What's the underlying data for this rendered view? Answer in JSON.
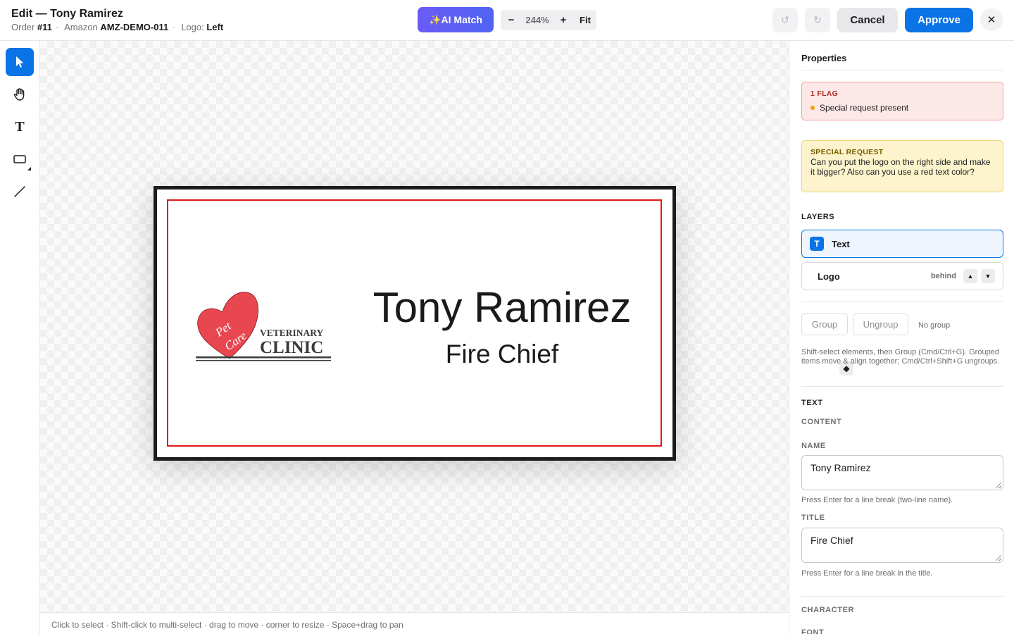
{
  "header": {
    "title": "Edit — Tony Ramirez",
    "order_label": "Order",
    "order_value": "#11",
    "marketplace_label": "Amazon",
    "marketplace_value": "AMZ-DEMO-011",
    "logo_label": "Logo:",
    "logo_value": "Left",
    "ai_match_label": "✨AI Match",
    "zoom_out": "−",
    "zoom_level": "244%",
    "zoom_in": "+",
    "fit_label": "Fit",
    "undo_icon": "↺",
    "redo_icon": "↻",
    "cancel_label": "Cancel",
    "approve_label": "Approve",
    "close_icon": "✕"
  },
  "tools": {
    "items": [
      "select-tool",
      "pan-tool",
      "text-tool",
      "shape-tool",
      "line-tool"
    ],
    "active": "select-tool",
    "text_tool_glyph": "T"
  },
  "badge": {
    "name": "Tony Ramirez",
    "title": "Fire Chief",
    "logo": {
      "heart_text_1": "Pet",
      "heart_text_2": "Care",
      "line_1": "VETERINARY",
      "line_2": "CLINIC"
    },
    "colors": {
      "frame": "#1c1c1c",
      "safe_zone": "#e01818",
      "heart": "#e8474f"
    }
  },
  "hint_bar": "Click to select · Shift-click to multi-select · drag to move · corner to resize · Space+drag to pan",
  "panel": {
    "title": "Properties",
    "flags": {
      "count_label": "1 FLAG",
      "items": [
        "Special request present"
      ]
    },
    "special_request": {
      "label": "SPECIAL REQUEST",
      "text": "Can you put the logo on the right side and make it bigger? Also can you use a red text color?"
    },
    "layers": {
      "label": "LAYERS",
      "items": [
        {
          "name": "Text",
          "icon": "T",
          "selected": true
        },
        {
          "name": "Logo",
          "icon": "◆",
          "note": "behind",
          "up": "▲",
          "down": "▼"
        }
      ]
    },
    "grouping": {
      "group_label": "Group",
      "ungroup_label": "Ungroup",
      "status": "No group",
      "help": "Shift-select elements, then Group (Cmd/Ctrl+G). Grouped items move & align together; Cmd/Ctrl+Shift+G ungroups."
    },
    "text_section": {
      "label": "TEXT",
      "content_label": "CONTENT",
      "name_label": "NAME",
      "name_value": "Tony Ramirez",
      "name_help": "Press Enter for a line break (two-line name).",
      "title_label": "TITLE",
      "title_value": "Fire Chief",
      "title_help": "Press Enter for a line break in the title."
    },
    "character_label": "CHARACTER",
    "font_label": "FONT"
  },
  "colors": {
    "accent": "#0a74e6",
    "ai_gradient_start": "#6a5cf6",
    "ai_gradient_end": "#4f64f2",
    "flag_bg": "#fde8e8",
    "request_bg": "#fdf3cc"
  }
}
